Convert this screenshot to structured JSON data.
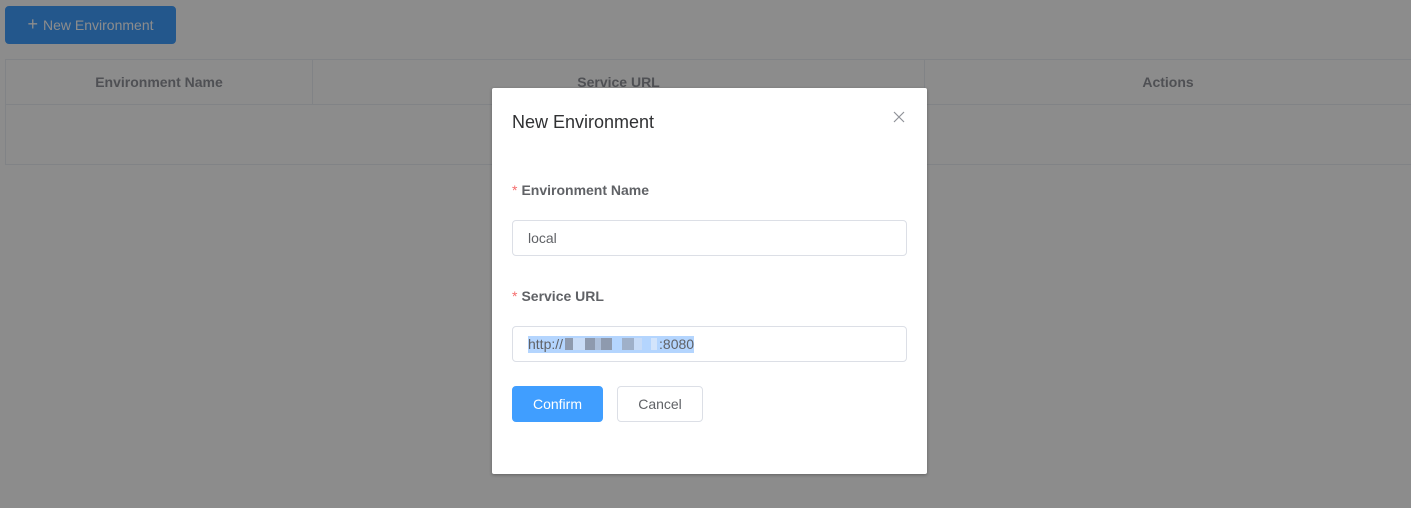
{
  "toolbar": {
    "new_environment_label": "New Environment",
    "plus_glyph": "+"
  },
  "table": {
    "columns": [
      "Environment Name",
      "Service URL",
      "Actions"
    ],
    "rows": []
  },
  "dialog": {
    "title": "New Environment",
    "fields": {
      "environment_name": {
        "label": "Environment Name",
        "required_mark": "*",
        "value": "local"
      },
      "service_url": {
        "label": "Service URL",
        "required_mark": "*",
        "value_prefix": "http://",
        "value_suffix": ":8080",
        "redacted": true,
        "selected": true
      }
    },
    "confirm_label": "Confirm",
    "cancel_label": "Cancel"
  },
  "colors": {
    "primary": "#409eff",
    "required": "#f56c6c",
    "selection": "#b4d5fe",
    "overlay": "rgba(0,0,0,0.45)",
    "header_text": "#909399"
  },
  "icons": {
    "plus": "plus-icon",
    "close": "close-icon"
  }
}
